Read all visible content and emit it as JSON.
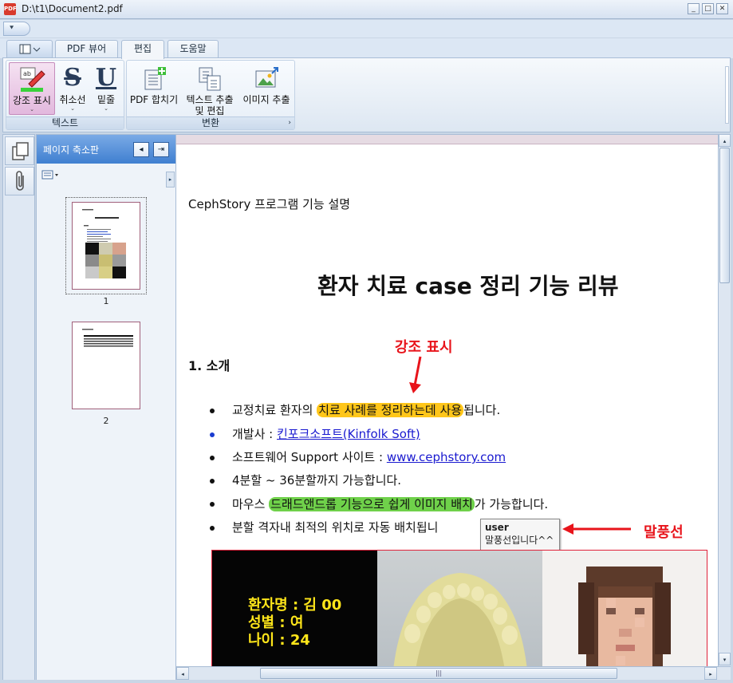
{
  "window": {
    "title": "D:\\t1\\Document2.pdf",
    "app_icon": "PDF",
    "controls": {
      "minimize": "_",
      "maximize": "□",
      "close": "✕"
    }
  },
  "quick_access": {
    "menu_glyph": "⯆"
  },
  "tabs": [
    {
      "label": "PDF 뷰어",
      "active": false
    },
    {
      "label": "편집",
      "active": true
    },
    {
      "label": "도움말",
      "active": false
    }
  ],
  "ribbon": {
    "groups": [
      {
        "label": "텍스트",
        "buttons": [
          {
            "label": "강조 표시",
            "selected": true,
            "has_dropdown": true,
            "icon": "highlighter-icon"
          },
          {
            "label": "취소선",
            "has_dropdown": true,
            "icon": "strikethrough-icon",
            "glyph": "S"
          },
          {
            "label": "밑줄",
            "has_dropdown": true,
            "icon": "underline-icon",
            "glyph": "U"
          }
        ]
      },
      {
        "label": "변환",
        "buttons": [
          {
            "label": "PDF 합치기",
            "icon": "merge-pdf-icon"
          },
          {
            "label_line1": "텍스트 추출",
            "label_line2": "및 편집",
            "icon": "extract-text-icon"
          },
          {
            "label": "이미지 추출",
            "icon": "extract-image-icon"
          }
        ]
      }
    ]
  },
  "sidebar": {
    "items": [
      {
        "icon": "pages-icon",
        "active": true
      },
      {
        "icon": "attachment-icon",
        "active": false
      }
    ]
  },
  "thumbnail_panel": {
    "title": "페이지 축소판",
    "pages": [
      {
        "number": "1",
        "selected": true
      },
      {
        "number": "2",
        "selected": false
      }
    ]
  },
  "document": {
    "header": "CephStory 프로그램 기능 설명",
    "title": "환자 치료 case 정리 기능 리뷰",
    "section1": "1. 소개",
    "annotation_highlight": "강조 표시",
    "annotation_balloon": "말풍선",
    "bullets": [
      {
        "before": "교정치료 환자의 ",
        "highlight": "치료 사례를 정리하는데 사용",
        "after": "됩니다.",
        "highlight_color": "#ffc61a"
      },
      {
        "before": "개발사 : ",
        "link": "킨포크소프트(Kinfolk Soft)",
        "bullet_color": "#1a3cd0"
      },
      {
        "before": "소프트웨어 Support 사이트 : ",
        "link": "www.cephstory.com"
      },
      {
        "before": "4분할 ~ 36분할까지 가능합니다."
      },
      {
        "before": "마우스 ",
        "highlight": "드래드앤드롭 기능으로 쉽게 이미지 배치",
        "after": "가 가능합니다.",
        "highlight_color": "#6fd14a"
      },
      {
        "before": "분할 격자내 최적의 위치로 자동 배치됩니"
      }
    ],
    "balloon": {
      "user": "user",
      "text": "말풍선입니다^^"
    },
    "patient_info": [
      {
        "label": "환자명 : 김 ",
        "value": "00"
      },
      {
        "label": "성별 : ",
        "value": "여"
      },
      {
        "label": "나이 : ",
        "value": "24"
      }
    ]
  },
  "colors": {
    "accent_red": "#e8141b",
    "highlight_yellow": "#ffc61a",
    "highlight_green": "#6fd14a",
    "link_blue": "#1a1ad0",
    "panel_header": "#3f7fd0"
  }
}
